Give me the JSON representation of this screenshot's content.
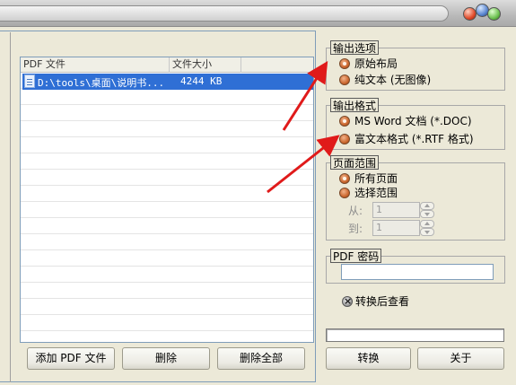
{
  "list": {
    "columns": [
      "PDF 文件",
      "文件大小"
    ],
    "rows": [
      {
        "name": "D:\\tools\\桌面\\说明书...",
        "size": "4244 KB"
      }
    ]
  },
  "bottom_buttons": {
    "add": "添加 PDF 文件",
    "delete": "删除",
    "delete_all": "删除全部"
  },
  "output_options": {
    "legend": "输出选项",
    "items": [
      {
        "label": "原始布局",
        "selected": true
      },
      {
        "label": "纯文本 (无图像)",
        "selected": false
      }
    ]
  },
  "output_format": {
    "legend": "输出格式",
    "items": [
      {
        "label": "MS Word 文档 (*.DOC)",
        "selected": true
      },
      {
        "label": "富文本格式 (*.RTF 格式)",
        "selected": false
      }
    ]
  },
  "page_range": {
    "legend": "页面范围",
    "items": [
      {
        "label": "所有页面",
        "selected": true
      },
      {
        "label": "选择范围",
        "selected": false
      }
    ],
    "from_label": "从:",
    "from_value": "1",
    "to_label": "到:",
    "to_value": "1"
  },
  "pdf_password": {
    "legend": "PDF 密码",
    "value": ""
  },
  "view_after_convert": {
    "label": "转换后查看"
  },
  "action_buttons": {
    "convert": "转换",
    "about": "关于"
  },
  "colors": {
    "selection": "#2f6fd5",
    "annotation_arrow": "#e01a1a",
    "background": "#ece9d8"
  }
}
